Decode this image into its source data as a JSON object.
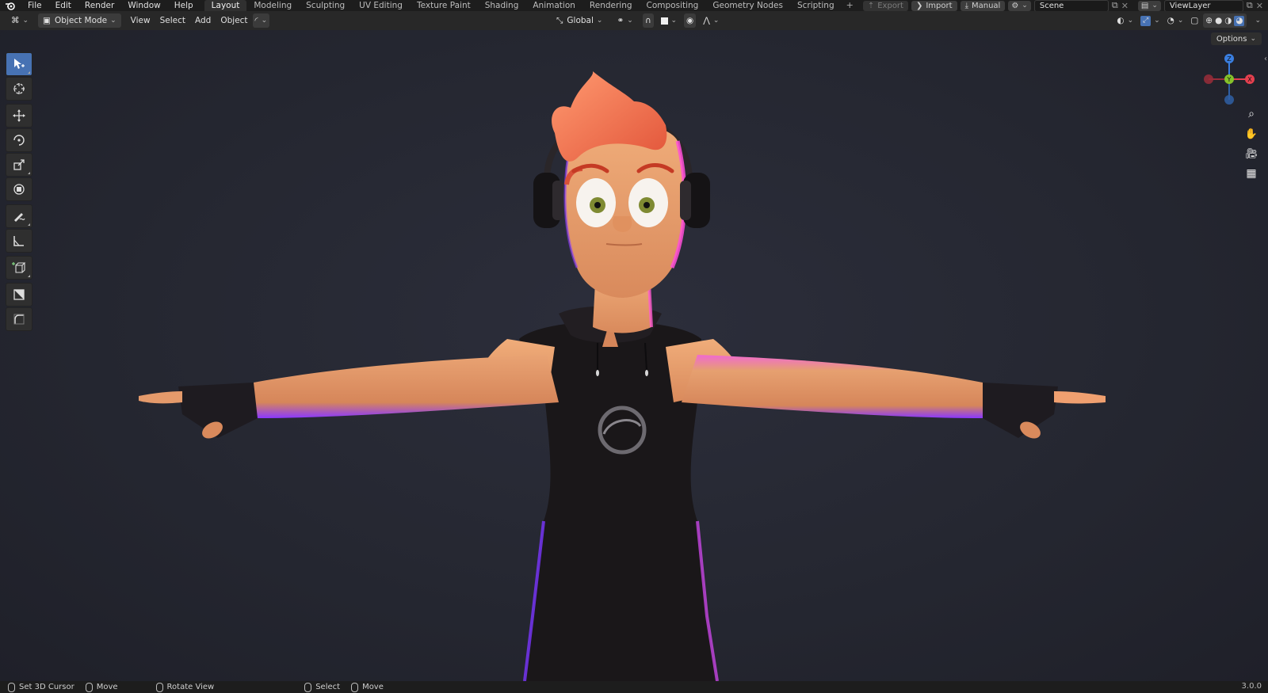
{
  "menu": [
    "File",
    "Edit",
    "Render",
    "Window",
    "Help"
  ],
  "workspace_tabs": [
    "Layout",
    "Modeling",
    "Sculpting",
    "UV Editing",
    "Texture Paint",
    "Shading",
    "Animation",
    "Rendering",
    "Compositing",
    "Geometry Nodes",
    "Scripting"
  ],
  "active_tab": "Layout",
  "add_tab_glyph": "+",
  "top_right": {
    "export_label": "Export",
    "import_label": "Import",
    "manual_label": "Manual",
    "scene_name": "Scene",
    "view_layer_name": "ViewLayer"
  },
  "header": {
    "mode": "Object Mode",
    "view": "View",
    "select": "Select",
    "add": "Add",
    "object": "Object",
    "transform_orientation": "Global"
  },
  "viewport": {
    "options_label": "Options",
    "gizmo": {
      "z": "Z",
      "y": "Y",
      "x": "X"
    },
    "gizmo_colors": {
      "x": "#e5404f",
      "y": "#86c22a",
      "z": "#3a7ee0"
    }
  },
  "tools": [
    {
      "icon": "select-box-icon",
      "active": true
    },
    {
      "icon": "cursor-icon",
      "active": false
    },
    {
      "icon": "move-icon",
      "active": false
    },
    {
      "icon": "rotate-icon",
      "active": false
    },
    {
      "icon": "scale-icon",
      "active": false
    },
    {
      "icon": "transform-icon",
      "active": false
    },
    {
      "icon": "annotate-icon",
      "active": false
    },
    {
      "icon": "measure-icon",
      "active": false
    },
    {
      "icon": "add-cube-icon",
      "active": false
    },
    {
      "icon": "extrude-icon",
      "active": false
    },
    {
      "icon": "bevel-icon",
      "active": false
    }
  ],
  "status": {
    "left1": "Set 3D Cursor",
    "left2": "Move",
    "middle": "Rotate View",
    "right1": "Select",
    "right2": "Move",
    "version": "3.0.0"
  },
  "colors": {
    "accent": "#4772b3",
    "skin": "#e8a070",
    "hair": "#f2704a",
    "rim_light": "#b040ff"
  }
}
